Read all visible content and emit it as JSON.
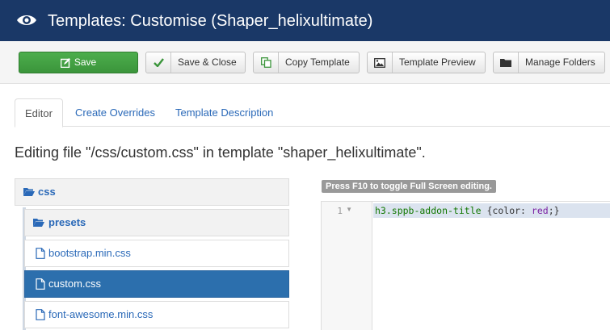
{
  "header": {
    "title": "Templates: Customise (Shaper_helixultimate)",
    "icon": "eye-icon"
  },
  "toolbar": {
    "save": "Save",
    "save_close": "Save & Close",
    "copy_template": "Copy Template",
    "template_preview": "Template Preview",
    "manage_folders": "Manage Folders"
  },
  "tabs": [
    "Editor",
    "Create Overrides",
    "Template Description"
  ],
  "editing_text": "Editing file \"/css/custom.css\" in template \"shaper_helixultimate\".",
  "tree": {
    "root": "css",
    "items": [
      {
        "label": "presets",
        "type": "folder"
      },
      {
        "label": "bootstrap.min.css",
        "type": "file"
      },
      {
        "label": "custom.css",
        "type": "file",
        "selected": true
      },
      {
        "label": "font-awesome.min.css",
        "type": "file"
      }
    ]
  },
  "editor": {
    "hint": "Press F10 to toggle Full Screen editing.",
    "line_number": "1",
    "code": {
      "selector": "h3.sppb-addon-title",
      "open": " {",
      "property": "color",
      "colon": ":",
      "value": " red",
      "close": ";}"
    }
  },
  "colors": {
    "header_bg": "#1a3867",
    "save_green": "#46a546",
    "selected_blue": "#2c6fad",
    "link_blue": "#2a69b8"
  }
}
